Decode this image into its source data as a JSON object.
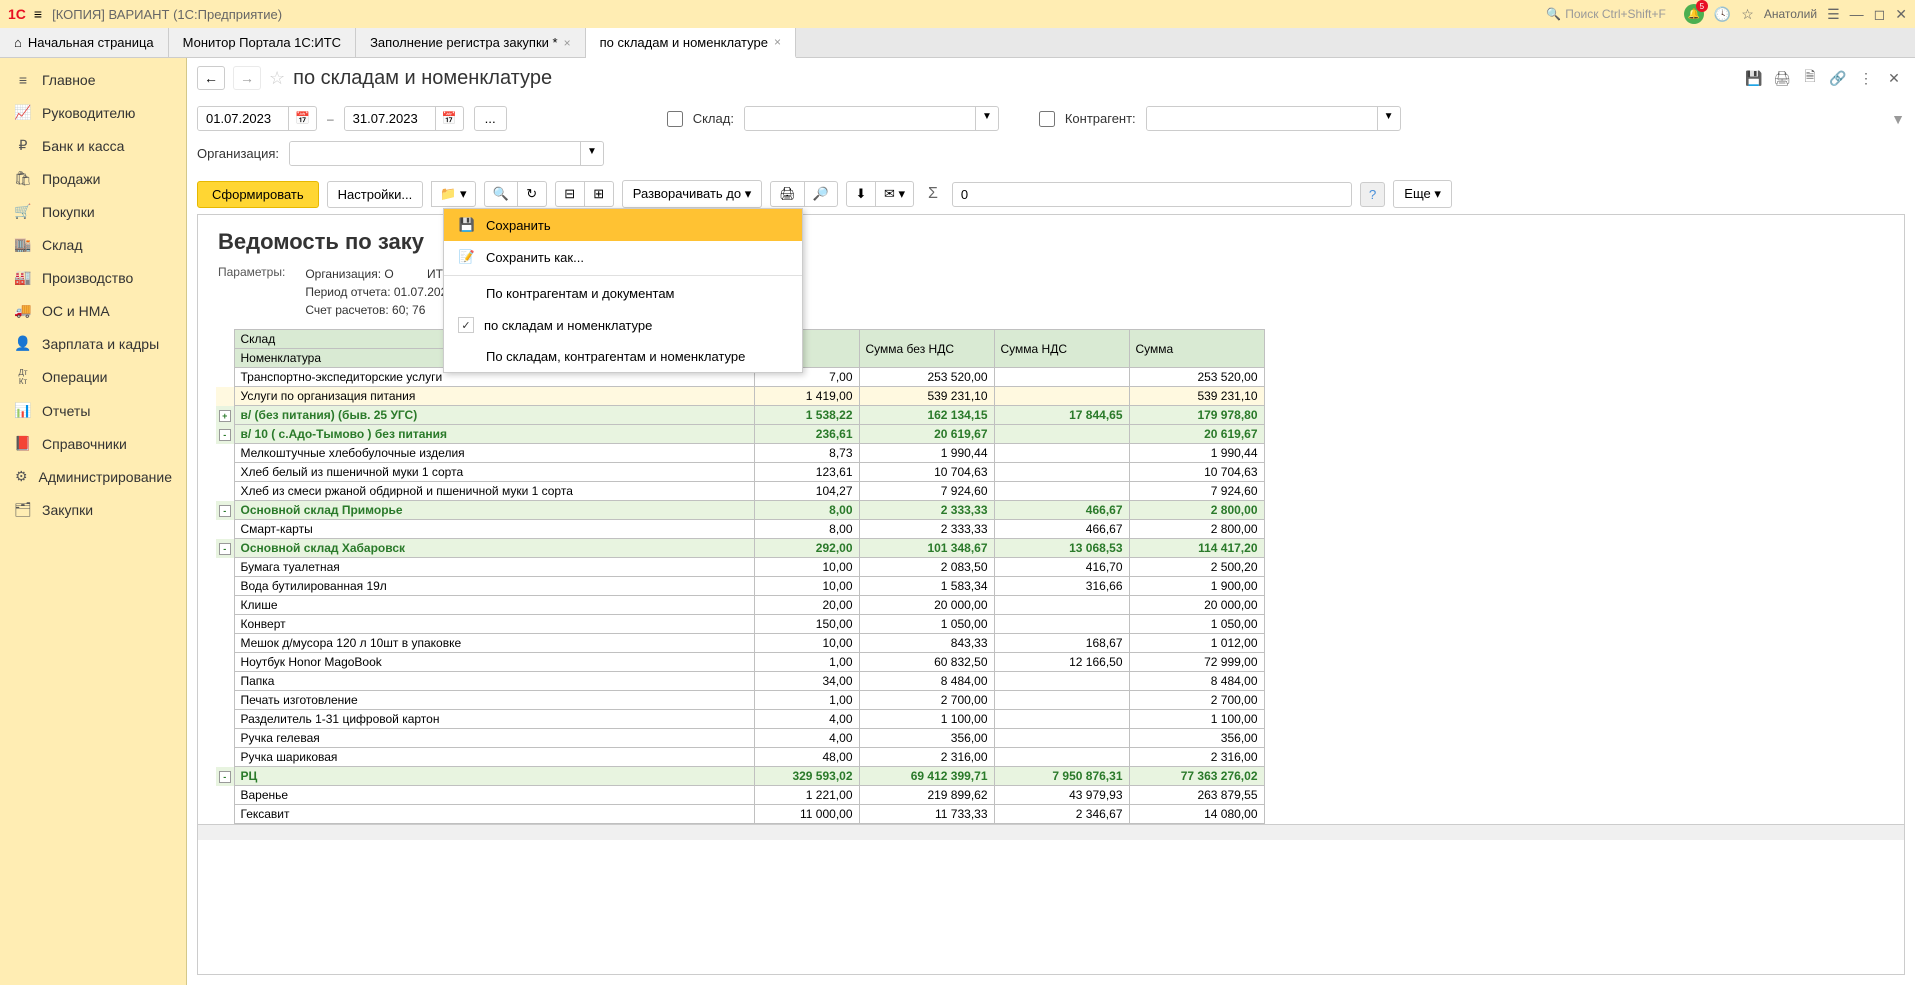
{
  "titlebar": {
    "logo": "1C",
    "app_title": "[КОПИЯ]                      ВАРИАНТ (1С:Предприятие)",
    "search_placeholder": "Поиск Ctrl+Shift+F",
    "notif_count": "5",
    "user": "Анатолий"
  },
  "tabs": {
    "home": "Начальная страница",
    "t1": "Монитор Портала 1С:ИТС",
    "t2": "Заполнение регистра закупки *",
    "t3": "по складам и номенклатуре"
  },
  "sidebar": [
    {
      "icon": "≡",
      "label": "Главное"
    },
    {
      "icon": "📈",
      "label": "Руководителю"
    },
    {
      "icon": "₽",
      "label": "Банк и касса"
    },
    {
      "icon": "🛍",
      "label": "Продажи"
    },
    {
      "icon": "🛒",
      "label": "Покупки"
    },
    {
      "icon": "🏬",
      "label": "Склад"
    },
    {
      "icon": "🏭",
      "label": "Производство"
    },
    {
      "icon": "🚚",
      "label": "ОС и НМА"
    },
    {
      "icon": "👤",
      "label": "Зарплата и кадры"
    },
    {
      "icon": "Дт Кт",
      "label": "Операции"
    },
    {
      "icon": "📊",
      "label": "Отчеты"
    },
    {
      "icon": "📕",
      "label": "Справочники"
    },
    {
      "icon": "⚙",
      "label": "Администрирование"
    },
    {
      "icon": "🗂",
      "label": "Закупки"
    }
  ],
  "page": {
    "title": "по складам и номенклатуре",
    "date_from": "01.07.2023",
    "date_to": "31.07.2023",
    "label_sklad": "Склад:",
    "label_kontragent": "Контрагент:",
    "label_org": "Организация:",
    "org_value": "",
    "btn_form": "Сформировать",
    "btn_settings": "Настройки...",
    "btn_expand": "Разворачивать до",
    "sum_value": "0",
    "btn_more": "Еще"
  },
  "dropdown": {
    "save": "Сохранить",
    "save_as": "Сохранить как...",
    "by_kontr": "По контрагентам и документам",
    "by_sklad_nom": "по складам и номенклатуре",
    "by_sklad_kontr_nom": "По складам, контрагентам и номенклатуре"
  },
  "report": {
    "title": "Ведомость по заку",
    "params_label": "Параметры:",
    "params_org": "Организация: О",
    "params_org_suffix": "ИТ",
    "params_period": "Период отчета: 01.07.2023 - 3",
    "params_account": "Счет расчетов: 60; 76",
    "hdr_sklad": "Склад",
    "hdr_nom": "Номенклатура",
    "hdr_sum_bez_nds": "Сумма без НДС",
    "hdr_sum_nds": "Сумма НДС",
    "hdr_sum": "Сумма"
  },
  "rows": [
    {
      "type": "item",
      "name": "Транспортно-экспедиторские услуги",
      "qty": "7,00",
      "bez": "253 520,00",
      "nds": "",
      "sum": "253 520,00"
    },
    {
      "type": "item",
      "name": "Услуги по организация питания",
      "qty": "1 419,00",
      "bez": "539 231,10",
      "nds": "",
      "sum": "539 231,10",
      "hl": true
    },
    {
      "type": "group",
      "pm": "+",
      "name": "в/             (без питания) (быв. 25 УГС)",
      "qty": "1 538,22",
      "bez": "162 134,15",
      "nds": "17 844,65",
      "sum": "179 978,80"
    },
    {
      "type": "group",
      "pm": "-",
      "name": "в/           10 ( с.Адо-Тымово ) без питания",
      "qty": "236,61",
      "bez": "20 619,67",
      "nds": "",
      "sum": "20 619,67"
    },
    {
      "type": "item",
      "name": "Мелкоштучные хлебобулочные изделия",
      "qty": "8,73",
      "bez": "1 990,44",
      "nds": "",
      "sum": "1 990,44"
    },
    {
      "type": "item",
      "name": "Хлеб белый из пшеничной муки 1 сорта",
      "qty": "123,61",
      "bez": "10 704,63",
      "nds": "",
      "sum": "10 704,63"
    },
    {
      "type": "item",
      "name": "Хлеб из смеси ржаной обдирной и пшеничной муки 1 сорта",
      "qty": "104,27",
      "bez": "7 924,60",
      "nds": "",
      "sum": "7 924,60"
    },
    {
      "type": "group",
      "pm": "-",
      "name": "Основной склад Приморье",
      "qty": "8,00",
      "bez": "2 333,33",
      "nds": "466,67",
      "sum": "2 800,00"
    },
    {
      "type": "item",
      "name": "Смарт-карты",
      "qty": "8,00",
      "bez": "2 333,33",
      "nds": "466,67",
      "sum": "2 800,00"
    },
    {
      "type": "group",
      "pm": "-",
      "name": "Основной склад Хабаровск",
      "qty": "292,00",
      "bez": "101 348,67",
      "nds": "13 068,53",
      "sum": "114 417,20"
    },
    {
      "type": "item",
      "name": "Бумага туалетная",
      "qty": "10,00",
      "bez": "2 083,50",
      "nds": "416,70",
      "sum": "2 500,20"
    },
    {
      "type": "item",
      "name": "Вода бутилированная 19л",
      "qty": "10,00",
      "bez": "1 583,34",
      "nds": "316,66",
      "sum": "1 900,00"
    },
    {
      "type": "item",
      "name": "Клише",
      "qty": "20,00",
      "bez": "20 000,00",
      "nds": "",
      "sum": "20 000,00"
    },
    {
      "type": "item",
      "name": "Конверт",
      "qty": "150,00",
      "bez": "1 050,00",
      "nds": "",
      "sum": "1 050,00"
    },
    {
      "type": "item",
      "name": "Мешок д/мусора 120 л 10шт в упаковке",
      "qty": "10,00",
      "bez": "843,33",
      "nds": "168,67",
      "sum": "1 012,00"
    },
    {
      "type": "item",
      "name": "Ноутбук Honor MagoBook",
      "qty": "1,00",
      "bez": "60 832,50",
      "nds": "12 166,50",
      "sum": "72 999,00"
    },
    {
      "type": "item",
      "name": "Папка",
      "qty": "34,00",
      "bez": "8 484,00",
      "nds": "",
      "sum": "8 484,00"
    },
    {
      "type": "item",
      "name": "Печать изготовление",
      "qty": "1,00",
      "bez": "2 700,00",
      "nds": "",
      "sum": "2 700,00"
    },
    {
      "type": "item",
      "name": "Разделитель 1-31 цифровой картон",
      "qty": "4,00",
      "bez": "1 100,00",
      "nds": "",
      "sum": "1 100,00"
    },
    {
      "type": "item",
      "name": "Ручка гелевая",
      "qty": "4,00",
      "bez": "356,00",
      "nds": "",
      "sum": "356,00"
    },
    {
      "type": "item",
      "name": "Ручка шариковая",
      "qty": "48,00",
      "bez": "2 316,00",
      "nds": "",
      "sum": "2 316,00"
    },
    {
      "type": "group",
      "pm": "-",
      "name": "РЦ",
      "qty": "329 593,02",
      "bez": "69 412 399,71",
      "nds": "7 950 876,31",
      "sum": "77 363 276,02"
    },
    {
      "type": "item",
      "name": "Варенье",
      "qty": "1 221,00",
      "bez": "219 899,62",
      "nds": "43 979,93",
      "sum": "263 879,55"
    },
    {
      "type": "item",
      "name": "Гексавит",
      "qty": "11 000,00",
      "bez": "11 733,33",
      "nds": "2 346,67",
      "sum": "14 080,00"
    }
  ]
}
